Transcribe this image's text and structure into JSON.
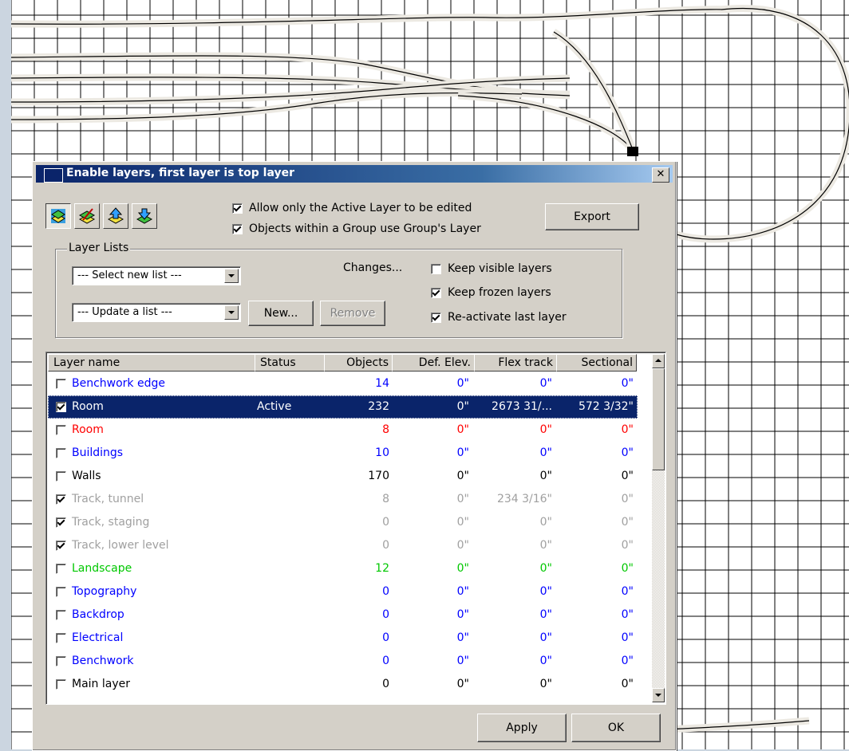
{
  "dialog": {
    "title": "Enable layers, first layer is top layer",
    "close_glyph": "✕"
  },
  "toolbar": {
    "icons": [
      "layers-icon",
      "edit-layer-icon",
      "move-up-icon",
      "move-down-icon"
    ]
  },
  "options": {
    "allow_active_only": {
      "label": "Allow only the Active Layer to be edited",
      "checked": true
    },
    "group_layer": {
      "label": "Objects within a Group use Group's Layer",
      "checked": true
    }
  },
  "export_label": "Export",
  "layer_lists": {
    "legend": "Layer Lists",
    "select_list": "--- Select new list ---",
    "update_list": "--- Update a list ---",
    "new_label": "New...",
    "remove_label": "Remove",
    "changes_label": "Changes...",
    "keep_visible": {
      "label": "Keep visible layers",
      "checked": false
    },
    "keep_frozen": {
      "label": "Keep frozen layers",
      "checked": true
    },
    "reactivate": {
      "label": "Re-activate last layer",
      "checked": true
    }
  },
  "table": {
    "columns": [
      "Layer name",
      "Status",
      "Objects",
      "Def. Elev.",
      "Flex track",
      "Sectional"
    ],
    "rows": [
      {
        "checked": false,
        "name": "Benchwork edge",
        "status": "",
        "objects": "14",
        "def_elev": "0\"",
        "flex": "0\"",
        "sectional": "0\"",
        "color": "blue"
      },
      {
        "checked": true,
        "name": "Room",
        "status": "Active",
        "objects": "232",
        "def_elev": "0\"",
        "flex": "2673 31/...",
        "sectional": "572 3/32\"",
        "color": "selected"
      },
      {
        "checked": false,
        "name": "Room",
        "status": "",
        "objects": "8",
        "def_elev": "0\"",
        "flex": "0\"",
        "sectional": "0\"",
        "color": "red"
      },
      {
        "checked": false,
        "name": "Buildings",
        "status": "",
        "objects": "10",
        "def_elev": "0\"",
        "flex": "0\"",
        "sectional": "0\"",
        "color": "blue"
      },
      {
        "checked": false,
        "name": "Walls",
        "status": "",
        "objects": "170",
        "def_elev": "0\"",
        "flex": "0\"",
        "sectional": "0\"",
        "color": "black"
      },
      {
        "checked": true,
        "name": "Track, tunnel",
        "status": "",
        "objects": "8",
        "def_elev": "0\"",
        "flex": "234 3/16\"",
        "sectional": "0\"",
        "color": "gray"
      },
      {
        "checked": true,
        "name": "Track, staging",
        "status": "",
        "objects": "0",
        "def_elev": "0\"",
        "flex": "0\"",
        "sectional": "0\"",
        "color": "gray"
      },
      {
        "checked": true,
        "name": "Track, lower level",
        "status": "",
        "objects": "0",
        "def_elev": "0\"",
        "flex": "0\"",
        "sectional": "0\"",
        "color": "gray"
      },
      {
        "checked": false,
        "name": "Landscape",
        "status": "",
        "objects": "12",
        "def_elev": "0\"",
        "flex": "0\"",
        "sectional": "0\"",
        "color": "green"
      },
      {
        "checked": false,
        "name": "Topography",
        "status": "",
        "objects": "0",
        "def_elev": "0\"",
        "flex": "0\"",
        "sectional": "0\"",
        "color": "blue"
      },
      {
        "checked": false,
        "name": "Backdrop",
        "status": "",
        "objects": "0",
        "def_elev": "0\"",
        "flex": "0\"",
        "sectional": "0\"",
        "color": "blue"
      },
      {
        "checked": false,
        "name": "Electrical",
        "status": "",
        "objects": "0",
        "def_elev": "0\"",
        "flex": "0\"",
        "sectional": "0\"",
        "color": "blue"
      },
      {
        "checked": false,
        "name": "Benchwork",
        "status": "",
        "objects": "0",
        "def_elev": "0\"",
        "flex": "0\"",
        "sectional": "0\"",
        "color": "blue"
      },
      {
        "checked": false,
        "name": "Main layer",
        "status": "",
        "objects": "0",
        "def_elev": "0\"",
        "flex": "0\"",
        "sectional": "0\"",
        "color": "black"
      }
    ]
  },
  "footer": {
    "apply_label": "Apply",
    "ok_label": "OK"
  }
}
